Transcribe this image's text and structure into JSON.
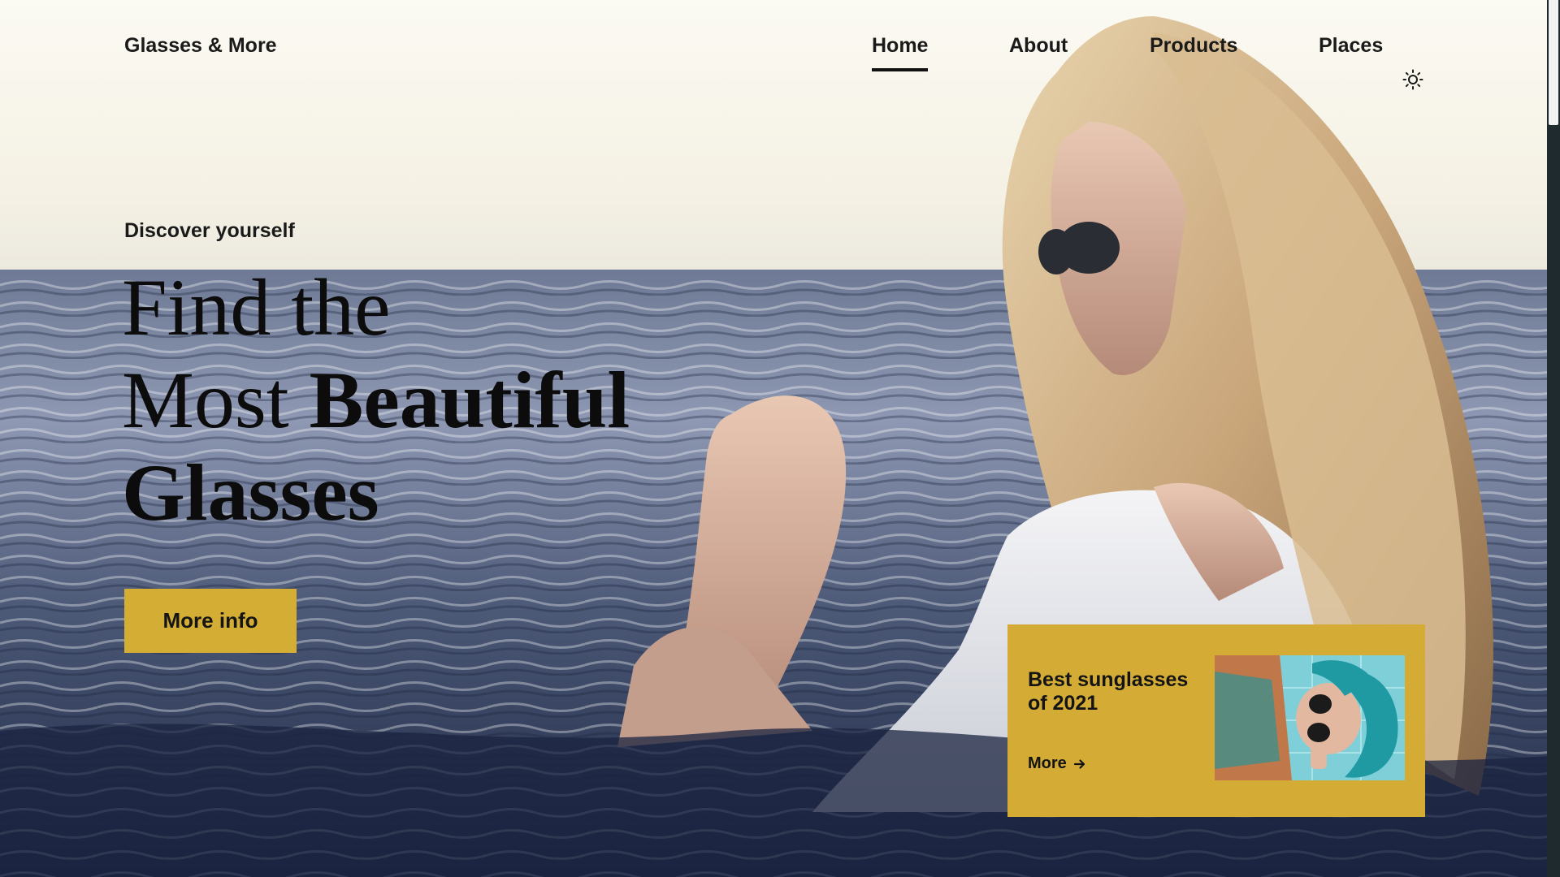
{
  "brand": {
    "name": "Glasses & More"
  },
  "nav": {
    "items": [
      {
        "label": "Home",
        "active": true
      },
      {
        "label": "About",
        "active": false
      },
      {
        "label": "Products",
        "active": false
      },
      {
        "label": "Places",
        "active": false
      }
    ],
    "theme_toggle_icon": "sun-icon"
  },
  "hero": {
    "eyebrow": "Discover yourself",
    "headline_line1": "Find the",
    "headline_line2_regular": "Most ",
    "headline_line2_bold": "Beautiful",
    "headline_line3": "Glasses",
    "cta_label": "More info"
  },
  "promo": {
    "title": "Best sunglasses of 2021",
    "more_label": "More",
    "more_icon": "arrow-right-icon"
  },
  "colors": {
    "accent": "#d3ad34",
    "text": "#1a1a1a",
    "scrollbar_track": "#1e2a2e"
  }
}
